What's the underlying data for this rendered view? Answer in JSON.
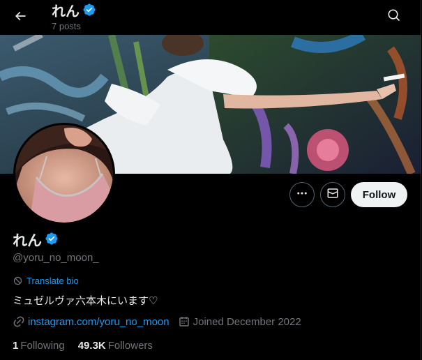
{
  "header": {
    "name": "れん",
    "posts": "7 posts"
  },
  "profile": {
    "display_name": "れん",
    "handle": "@yoru_no_moon_",
    "translate_label": "Translate bio",
    "bio": "ミュゼルヴァ六本木にいます♡",
    "link": "instagram.com/yoru_no_moon",
    "joined": "Joined December 2022",
    "following_count": "1",
    "following_label": "Following",
    "followers_count": "49.3K",
    "followers_label": "Followers"
  },
  "actions": {
    "follow_label": "Follow"
  },
  "icons": {
    "back": "back-arrow-icon",
    "search": "search-icon",
    "more": "more-dots-icon",
    "message": "envelope-icon",
    "verified": "verified-badge-icon",
    "translate": "translate-icon",
    "link": "link-icon",
    "calendar": "calendar-icon"
  },
  "colors": {
    "background": "#000000",
    "accent": "#1d9bf0",
    "text": "#e7e9ea",
    "muted": "#71767b",
    "follow_bg": "#eff3f4"
  }
}
